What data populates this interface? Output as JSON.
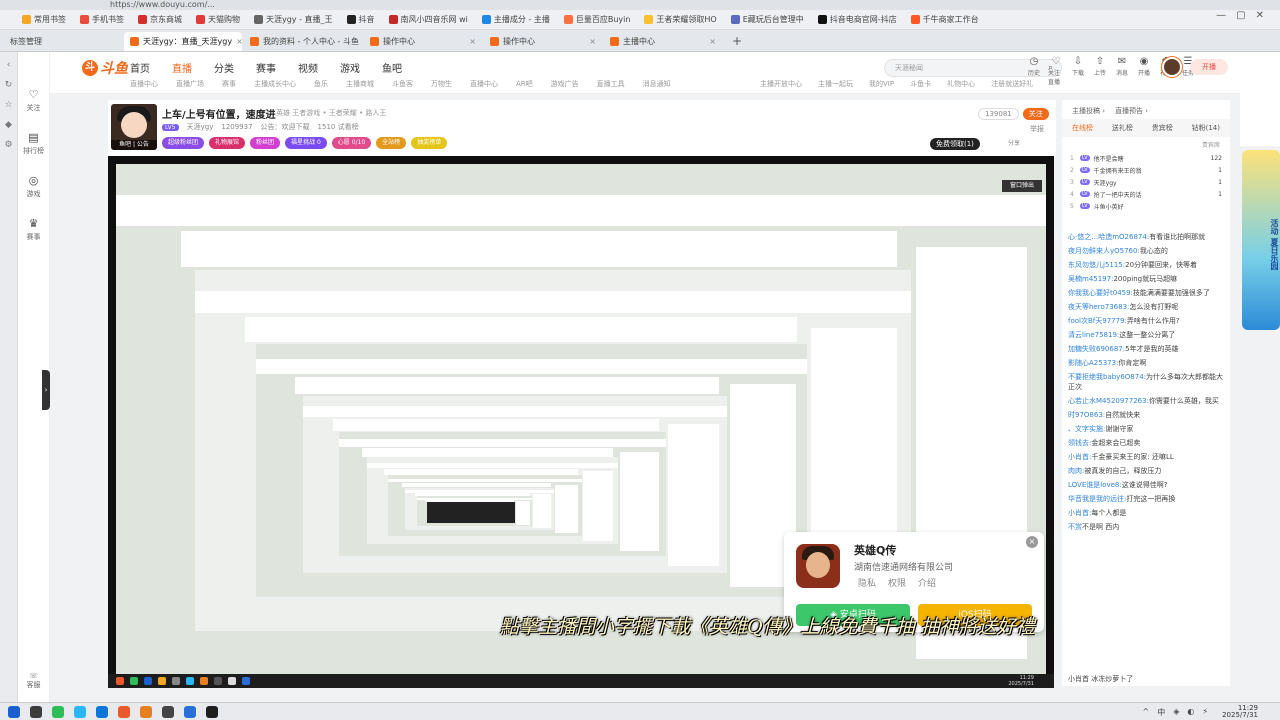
{
  "browser": {
    "address": "https://www.douyu.com/...",
    "bookmarks": [
      "常用书签",
      "手机书签",
      "京东商城",
      "天猫购物",
      "天涯ygy - 直播_王",
      "抖音",
      "南风小四音乐网 wi",
      "主播成分 - 主播",
      "巨量百应Buyin",
      "王者荣耀领取HO",
      "E藏玩后台管理中",
      "抖音电商官网-抖店",
      "千牛商家工作台"
    ],
    "bookmark_colors": [
      "#f5a623",
      "#e94b3c",
      "#d32f2f",
      "#e53935",
      "#666666",
      "#222222",
      "#c62828",
      "#1e88e5",
      "#ff7043",
      "#fbc02d",
      "#5c6bc0",
      "#111111",
      "#ff5722"
    ],
    "bookmark_extra": "标签管理",
    "tabs": [
      "天涯ygy：直播_天涯ygy",
      "我的资料 - 个人中心 - 斗鱼",
      "操作中心",
      "操作中心",
      "主播中心"
    ]
  },
  "left_nav": {
    "items": [
      {
        "icon": "heart-icon",
        "glyph": "♡",
        "label": "关注"
      },
      {
        "icon": "rank-icon",
        "glyph": "▤",
        "label": "排行榜"
      },
      {
        "icon": "game-icon",
        "glyph": "◎",
        "label": "游戏"
      },
      {
        "icon": "trophy-icon",
        "glyph": "♛",
        "label": "赛事"
      }
    ],
    "bottom_label": "客服"
  },
  "header": {
    "logo_text": "斗鱼",
    "nav": [
      "首页",
      "直播",
      "分类",
      "赛事",
      "视频",
      "游戏",
      "鱼吧"
    ],
    "active_nav": "直播",
    "sub_nav": [
      "直播中心",
      "直播广场",
      "赛事",
      "主播成长中心",
      "鱼乐",
      "主播商城",
      "斗鱼客",
      "万物生",
      "直播中心",
      "AR吧",
      "游戏广告",
      "直播工具",
      "消息通知"
    ],
    "sub_nav_right": [
      "主播开放中心",
      "主播一起玩",
      "我的VIP",
      "斗鱼卡",
      "礼物中心",
      "注册就送好礼"
    ],
    "search_placeholder": "天涯秘闻",
    "icons": [
      {
        "name": "history-icon",
        "glyph": "◷",
        "label": "历史"
      },
      {
        "name": "follow-icon",
        "glyph": "♡",
        "label": "关注直播"
      },
      {
        "name": "download-icon",
        "glyph": "⇩",
        "label": "下载"
      },
      {
        "name": "upload-icon",
        "glyph": "⇧",
        "label": "上传"
      },
      {
        "name": "message-icon",
        "glyph": "✉",
        "label": "消息"
      },
      {
        "name": "live-icon",
        "glyph": "◉",
        "label": "开播"
      },
      {
        "name": "gift-icon",
        "glyph": "✿",
        "label": "礼物"
      },
      {
        "name": "task-icon",
        "glyph": "☰",
        "label": "任务"
      }
    ],
    "open_button": "开播"
  },
  "room": {
    "title": "上车/上号有位置，速度进",
    "tags": "英雄  王者游戏 • 王者荣耀 • 路人王",
    "level": "LV5",
    "streamer_name": "天涯ygy",
    "hot": "1209937",
    "notice": "公告：欢迎下载",
    "fans": "1510 试看榜",
    "avatar_caption": "鱼吧 | 公告",
    "badges": [
      {
        "text": "超级粉丝团",
        "color": "#8a4de8"
      },
      {
        "text": "礼物展馆",
        "color": "#d8306b"
      },
      {
        "text": "粉丝团",
        "color": "#d23fd1"
      },
      {
        "text": "福星挑战 0",
        "color": "#7a4cf0"
      },
      {
        "text": "心愿 0/10",
        "color": "#e14a8c"
      },
      {
        "text": "全站榜",
        "color": "#e29a1d"
      },
      {
        "text": "抽奖榜单",
        "color": "#e6c51a"
      }
    ],
    "follow_count": "139081",
    "follow_label": "关注",
    "report_label": "举报",
    "free_gift": "免费领取(1)",
    "share_label": "分享"
  },
  "video": {
    "float_label": "窗口弹出",
    "caption": "點擊主播間小字擺下載《英雄Q傳》上線免費千抽 抽神將送好禮",
    "inner_clock_time": "11:29",
    "inner_clock_date": "2025/7/31"
  },
  "ad": {
    "name": "英雄Q传",
    "company": "湖南信速通网络有限公司",
    "links": [
      "隐私",
      "权限",
      "介绍"
    ],
    "android_label": "安卓扫码",
    "ios_label": "iOS扫码",
    "close": "×"
  },
  "rank": {
    "head": [
      "主播投稿 ›",
      "直播预告 ›"
    ],
    "tabs": [
      "在线榜",
      "送礼榜",
      "贵宾榜",
      "钻粉(14)"
    ],
    "active_tab": "在线榜",
    "sub": "贵宾席",
    "rows": [
      {
        "n": "1",
        "lvl": "LV",
        "name": "他不是会瞎",
        "val": "122"
      },
      {
        "n": "2",
        "lvl": "LV",
        "name": "千金拥有来王的翁",
        "val": "1"
      },
      {
        "n": "3",
        "lvl": "LV",
        "name": "天涯ygy",
        "val": "1"
      },
      {
        "n": "4",
        "lvl": "LV",
        "name": "抢了一把中天的话",
        "val": "1"
      },
      {
        "n": "5",
        "lvl": "LV",
        "name": "斗鱼小英好",
        "val": ""
      }
    ]
  },
  "chat": [
    {
      "u": "心·悠之…哈造mO26874:",
      "t": "有看谁比拍啊那就"
    },
    {
      "u": "夜月勿鲜来人yO5760:",
      "t": "我心态的"
    },
    {
      "u": "东风勿悠儿j5115:",
      "t": "20分钟要回来，快等着"
    },
    {
      "u": "吴楠m45197:",
      "t": "200ping就玩马超嘛"
    },
    {
      "u": "你我我心要好t0459:",
      "t": "技能满满要要加强很多了"
    },
    {
      "u": "夜天等hero73683:",
      "t": "怎么没有打野呢"
    },
    {
      "u": "fool次Bf天97779:",
      "t": "弄啥有什么作用?"
    },
    {
      "u": "清云line75819:",
      "t": "这整一整公分离了"
    },
    {
      "u": "加糖失败690687:",
      "t": "5年才是我的英雄"
    },
    {
      "u": "影随心A25373:",
      "t": "你肯定啊"
    },
    {
      "u": "不要拒绝我baby6O874:",
      "t": "为什么多每次大郎都能大正次"
    },
    {
      "u": "心若止水M4520977263:",
      "t": "你需要什么英雄，我买"
    },
    {
      "u": "时97O863:",
      "t": "自然就快来"
    },
    {
      "u": "、文字实施:",
      "t": "谢谢守家"
    },
    {
      "u": "领钱去:",
      "t": "金超来会已超卖"
    },
    {
      "u": "小肖首:",
      "t": "千金豪买来王的家: 还嘛LL"
    },
    {
      "u": "肉肉:",
      "t": "被真发的自己，释放压力"
    },
    {
      "u": "LOVE谁是love8:",
      "t": "这谁说得佳啊?"
    },
    {
      "u": "华音我是我的远往:",
      "t": "打完这一把再换"
    },
    {
      "u": "小肖首:",
      "t": "每个人都是"
    },
    {
      "u": "不赏",
      "t": "不是啊  西内"
    }
  ],
  "chat_bottom": "小肖首  冰冻炒萝卜了",
  "promo": "活动 夏日乐园",
  "taskbar": {
    "time": "11:29",
    "date": "2025/7/31",
    "tray": [
      "^",
      "中",
      "◈",
      "◐",
      "⚡"
    ],
    "icon_colors": [
      "#1b5fcf",
      "#3b3b3b",
      "#2ebd59",
      "#29b6f6",
      "#0a77d8",
      "#e95a2b",
      "#e67e22",
      "#444444",
      "#2a6fd8",
      "#1f1f1f"
    ]
  }
}
